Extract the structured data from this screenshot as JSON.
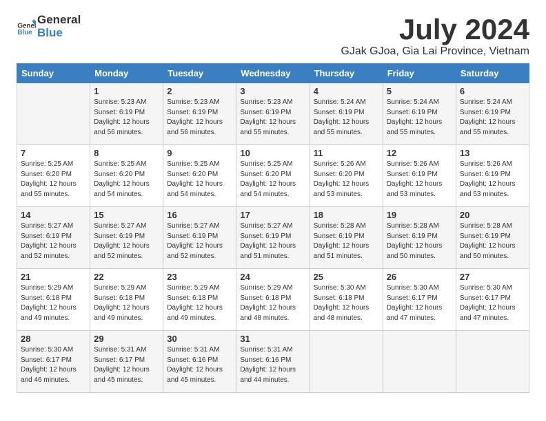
{
  "header": {
    "logo_general": "General",
    "logo_blue": "Blue",
    "month": "July 2024",
    "location": "GJak GJoa, Gia Lai Province, Vietnam"
  },
  "weekdays": [
    "Sunday",
    "Monday",
    "Tuesday",
    "Wednesday",
    "Thursday",
    "Friday",
    "Saturday"
  ],
  "weeks": [
    [
      {
        "day": "",
        "info": ""
      },
      {
        "day": "1",
        "info": "Sunrise: 5:23 AM\nSunset: 6:19 PM\nDaylight: 12 hours\nand 56 minutes."
      },
      {
        "day": "2",
        "info": "Sunrise: 5:23 AM\nSunset: 6:19 PM\nDaylight: 12 hours\nand 56 minutes."
      },
      {
        "day": "3",
        "info": "Sunrise: 5:23 AM\nSunset: 6:19 PM\nDaylight: 12 hours\nand 55 minutes."
      },
      {
        "day": "4",
        "info": "Sunrise: 5:24 AM\nSunset: 6:19 PM\nDaylight: 12 hours\nand 55 minutes."
      },
      {
        "day": "5",
        "info": "Sunrise: 5:24 AM\nSunset: 6:19 PM\nDaylight: 12 hours\nand 55 minutes."
      },
      {
        "day": "6",
        "info": "Sunrise: 5:24 AM\nSunset: 6:19 PM\nDaylight: 12 hours\nand 55 minutes."
      }
    ],
    [
      {
        "day": "7",
        "info": "Sunrise: 5:25 AM\nSunset: 6:20 PM\nDaylight: 12 hours\nand 55 minutes."
      },
      {
        "day": "8",
        "info": "Sunrise: 5:25 AM\nSunset: 6:20 PM\nDaylight: 12 hours\nand 54 minutes."
      },
      {
        "day": "9",
        "info": "Sunrise: 5:25 AM\nSunset: 6:20 PM\nDaylight: 12 hours\nand 54 minutes."
      },
      {
        "day": "10",
        "info": "Sunrise: 5:25 AM\nSunset: 6:20 PM\nDaylight: 12 hours\nand 54 minutes."
      },
      {
        "day": "11",
        "info": "Sunrise: 5:26 AM\nSunset: 6:20 PM\nDaylight: 12 hours\nand 53 minutes."
      },
      {
        "day": "12",
        "info": "Sunrise: 5:26 AM\nSunset: 6:19 PM\nDaylight: 12 hours\nand 53 minutes."
      },
      {
        "day": "13",
        "info": "Sunrise: 5:26 AM\nSunset: 6:19 PM\nDaylight: 12 hours\nand 53 minutes."
      }
    ],
    [
      {
        "day": "14",
        "info": "Sunrise: 5:27 AM\nSunset: 6:19 PM\nDaylight: 12 hours\nand 52 minutes."
      },
      {
        "day": "15",
        "info": "Sunrise: 5:27 AM\nSunset: 6:19 PM\nDaylight: 12 hours\nand 52 minutes."
      },
      {
        "day": "16",
        "info": "Sunrise: 5:27 AM\nSunset: 6:19 PM\nDaylight: 12 hours\nand 52 minutes."
      },
      {
        "day": "17",
        "info": "Sunrise: 5:27 AM\nSunset: 6:19 PM\nDaylight: 12 hours\nand 51 minutes."
      },
      {
        "day": "18",
        "info": "Sunrise: 5:28 AM\nSunset: 6:19 PM\nDaylight: 12 hours\nand 51 minutes."
      },
      {
        "day": "19",
        "info": "Sunrise: 5:28 AM\nSunset: 6:19 PM\nDaylight: 12 hours\nand 50 minutes."
      },
      {
        "day": "20",
        "info": "Sunrise: 5:28 AM\nSunset: 6:19 PM\nDaylight: 12 hours\nand 50 minutes."
      }
    ],
    [
      {
        "day": "21",
        "info": "Sunrise: 5:29 AM\nSunset: 6:18 PM\nDaylight: 12 hours\nand 49 minutes."
      },
      {
        "day": "22",
        "info": "Sunrise: 5:29 AM\nSunset: 6:18 PM\nDaylight: 12 hours\nand 49 minutes."
      },
      {
        "day": "23",
        "info": "Sunrise: 5:29 AM\nSunset: 6:18 PM\nDaylight: 12 hours\nand 49 minutes."
      },
      {
        "day": "24",
        "info": "Sunrise: 5:29 AM\nSunset: 6:18 PM\nDaylight: 12 hours\nand 48 minutes."
      },
      {
        "day": "25",
        "info": "Sunrise: 5:30 AM\nSunset: 6:18 PM\nDaylight: 12 hours\nand 48 minutes."
      },
      {
        "day": "26",
        "info": "Sunrise: 5:30 AM\nSunset: 6:17 PM\nDaylight: 12 hours\nand 47 minutes."
      },
      {
        "day": "27",
        "info": "Sunrise: 5:30 AM\nSunset: 6:17 PM\nDaylight: 12 hours\nand 47 minutes."
      }
    ],
    [
      {
        "day": "28",
        "info": "Sunrise: 5:30 AM\nSunset: 6:17 PM\nDaylight: 12 hours\nand 46 minutes."
      },
      {
        "day": "29",
        "info": "Sunrise: 5:31 AM\nSunset: 6:17 PM\nDaylight: 12 hours\nand 45 minutes."
      },
      {
        "day": "30",
        "info": "Sunrise: 5:31 AM\nSunset: 6:16 PM\nDaylight: 12 hours\nand 45 minutes."
      },
      {
        "day": "31",
        "info": "Sunrise: 5:31 AM\nSunset: 6:16 PM\nDaylight: 12 hours\nand 44 minutes."
      },
      {
        "day": "",
        "info": ""
      },
      {
        "day": "",
        "info": ""
      },
      {
        "day": "",
        "info": ""
      }
    ]
  ]
}
